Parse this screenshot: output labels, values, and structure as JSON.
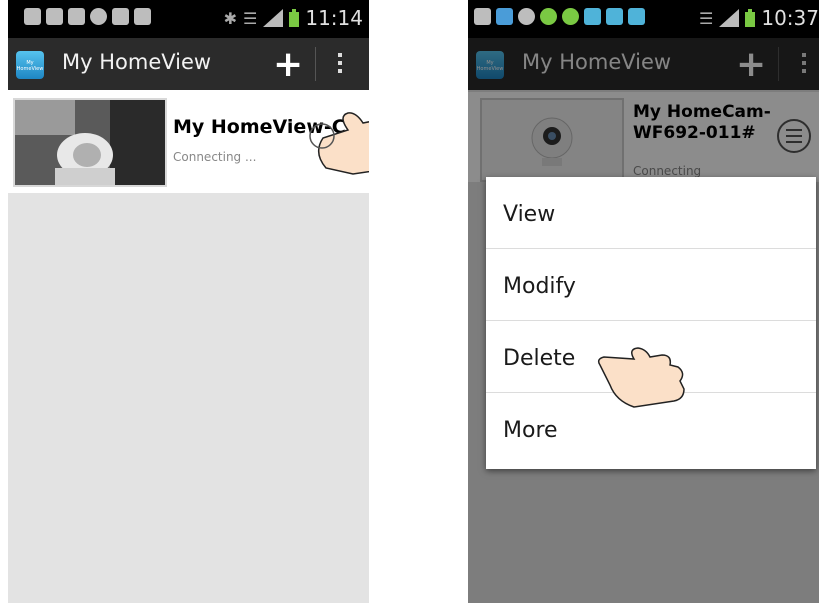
{
  "screen1": {
    "status_time": "11:14",
    "app_title": "My HomeView",
    "app_icon_text": "My HomeView",
    "camera_name": "My HomeView-C",
    "camera_status": "Connecting ..."
  },
  "screen2": {
    "status_time": "10:37",
    "app_title": "My HomeView",
    "camera_name_line1": "My HomeCam-",
    "camera_name_line2": "WF692-011#",
    "camera_status": "Connecting",
    "menu": [
      "View",
      "Modify",
      "Delete",
      "More"
    ]
  }
}
